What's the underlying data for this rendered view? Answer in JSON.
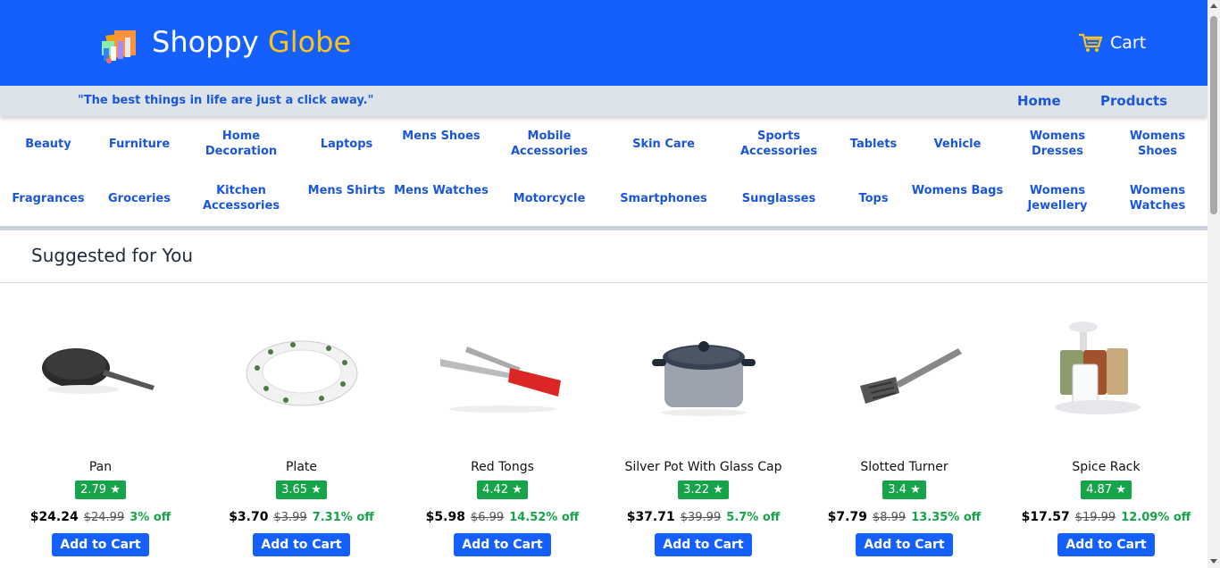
{
  "header": {
    "brand_main": "Shoppy ",
    "brand_accent": "Globe",
    "cart_label": "Cart",
    "colors": {
      "primary": "#1560fd",
      "accent": "#fcc417"
    }
  },
  "subbar": {
    "tagline": "\"The best things in life are just a click away.\"",
    "nav": [
      "Home",
      "Products"
    ]
  },
  "categories": {
    "row1": [
      "Beauty",
      "Furniture",
      "Home Decoration",
      "Laptops",
      "Mens Shoes",
      "Mobile Accessories",
      "Skin Care",
      "Sports Accessories",
      "Tablets",
      "Vehicle",
      "Womens Dresses",
      "Womens Shoes"
    ],
    "row2": [
      "Fragrances",
      "Groceries",
      "Kitchen Accessories",
      "Mens Shirts",
      "Mens Watches",
      "Motorcycle",
      "Smartphones",
      "Sunglasses",
      "Tops",
      "Womens Bags",
      "Womens Jewellery",
      "Womens Watches"
    ]
  },
  "section": {
    "title": "Suggested for You"
  },
  "products": [
    {
      "name": "Pan",
      "rating": "2.79",
      "price": "$24.24",
      "mrp": "$24.99",
      "off": "3% off",
      "icon": "pan-image"
    },
    {
      "name": "Plate",
      "rating": "3.65",
      "price": "$3.70",
      "mrp": "$3.99",
      "off": "7.31% off",
      "icon": "plate-image"
    },
    {
      "name": "Red Tongs",
      "rating": "4.42",
      "price": "$5.98",
      "mrp": "$6.99",
      "off": "14.52% off",
      "icon": "tongs-image"
    },
    {
      "name": "Silver Pot With Glass Cap",
      "rating": "3.22",
      "price": "$37.71",
      "mrp": "$39.99",
      "off": "5.7% off",
      "icon": "pot-image"
    },
    {
      "name": "Slotted Turner",
      "rating": "3.4",
      "price": "$7.79",
      "mrp": "$8.99",
      "off": "13.35% off",
      "icon": "turner-image"
    },
    {
      "name": "Spice Rack",
      "rating": "4.87",
      "price": "$17.57",
      "mrp": "$19.99",
      "off": "12.09% off",
      "icon": "spice-rack-image"
    }
  ],
  "add_to_cart_label": "Add to Cart",
  "star": "★"
}
